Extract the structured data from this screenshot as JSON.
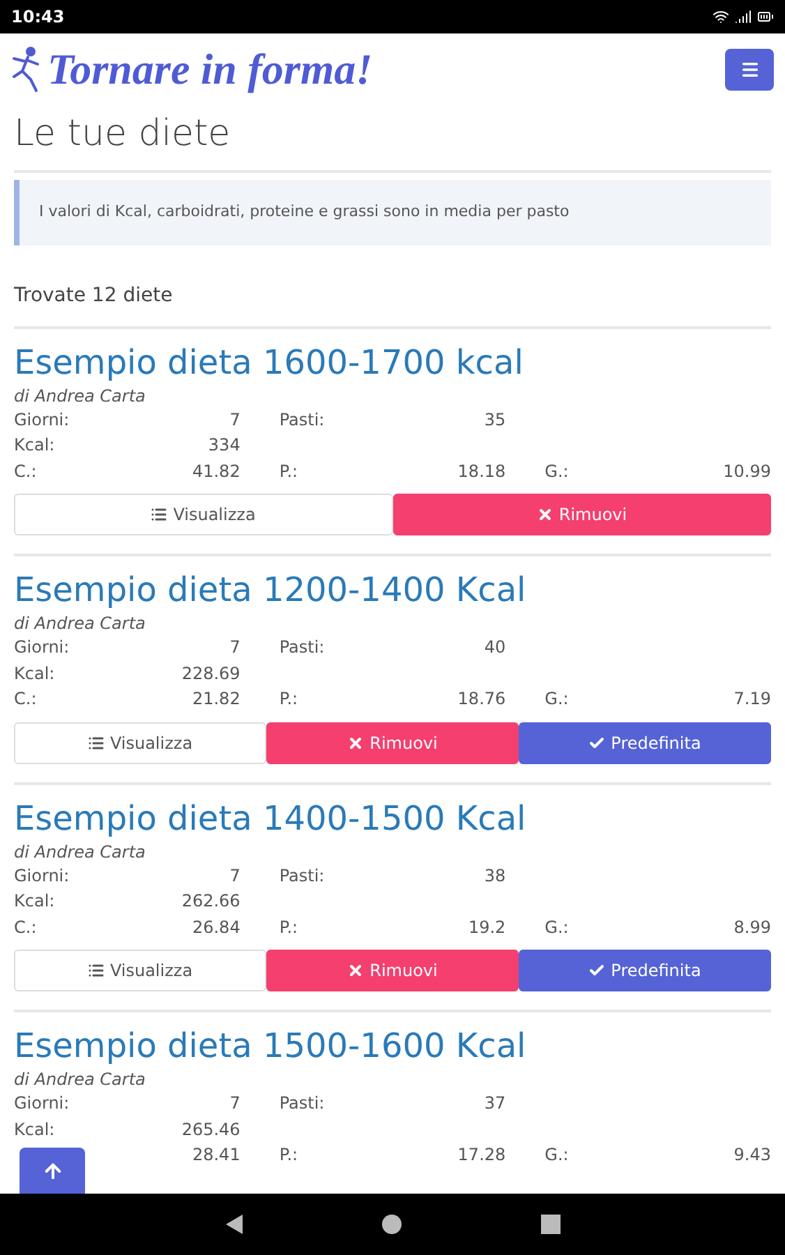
{
  "status_bar": {
    "time": "10:43"
  },
  "app": {
    "title": "Tornare in forma!"
  },
  "page": {
    "heading": "Le tue diete",
    "info": "I valori di Kcal, carboidrati, proteine e grassi sono in media per pasto",
    "count": "Trovate 12 diete"
  },
  "diets": [
    {
      "title": "Esempio dieta 1600-1700 kcal",
      "author": "di Andrea Carta",
      "rows": [
        [
          {
            "label": "Giorni:",
            "value": "7"
          },
          {
            "label": "Pasti:",
            "value": "35"
          }
        ],
        [
          {
            "label": "Kcal:",
            "value": "334"
          }
        ],
        [
          {
            "label": "C.:",
            "value": "41.82"
          },
          {
            "label": "P.:",
            "value": "18.18"
          },
          {
            "label": "G.:",
            "value": "10.99"
          }
        ]
      ],
      "actions": [
        {
          "kind": "view",
          "label": "Visualizza"
        },
        {
          "kind": "remove",
          "label": "Rimuovi"
        }
      ]
    },
    {
      "title": "Esempio dieta 1200-1400 Kcal",
      "author": "di Andrea Carta",
      "rows": [
        [
          {
            "label": "Giorni:",
            "value": "7"
          },
          {
            "label": "Pasti:",
            "value": "40"
          }
        ],
        [
          {
            "label": "Kcal:",
            "value": "228.69"
          }
        ],
        [
          {
            "label": "C.:",
            "value": "21.82"
          },
          {
            "label": "P.:",
            "value": "18.76"
          },
          {
            "label": "G.:",
            "value": "7.19"
          }
        ]
      ],
      "actions": [
        {
          "kind": "view",
          "label": "Visualizza"
        },
        {
          "kind": "remove",
          "label": "Rimuovi"
        },
        {
          "kind": "default",
          "label": "Predefinita"
        }
      ]
    },
    {
      "title": "Esempio dieta 1400-1500 Kcal",
      "author": "di Andrea Carta",
      "rows": [
        [
          {
            "label": "Giorni:",
            "value": "7"
          },
          {
            "label": "Pasti:",
            "value": "38"
          }
        ],
        [
          {
            "label": "Kcal:",
            "value": "262.66"
          }
        ],
        [
          {
            "label": "C.:",
            "value": "26.84"
          },
          {
            "label": "P.:",
            "value": "19.2"
          },
          {
            "label": "G.:",
            "value": "8.99"
          }
        ]
      ],
      "actions": [
        {
          "kind": "view",
          "label": "Visualizza"
        },
        {
          "kind": "remove",
          "label": "Rimuovi"
        },
        {
          "kind": "default",
          "label": "Predefinita"
        }
      ]
    },
    {
      "title": "Esempio dieta 1500-1600 Kcal",
      "author": "di Andrea Carta",
      "rows": [
        [
          {
            "label": "Giorni:",
            "value": "7"
          },
          {
            "label": "Pasti:",
            "value": "37"
          }
        ],
        [
          {
            "label": "Kcal:",
            "value": "265.46"
          }
        ],
        [
          {
            "value": "28.41"
          },
          {
            "label": "P.:",
            "value": "17.28"
          },
          {
            "label": "G.:",
            "value": "9.43"
          }
        ]
      ]
    }
  ]
}
